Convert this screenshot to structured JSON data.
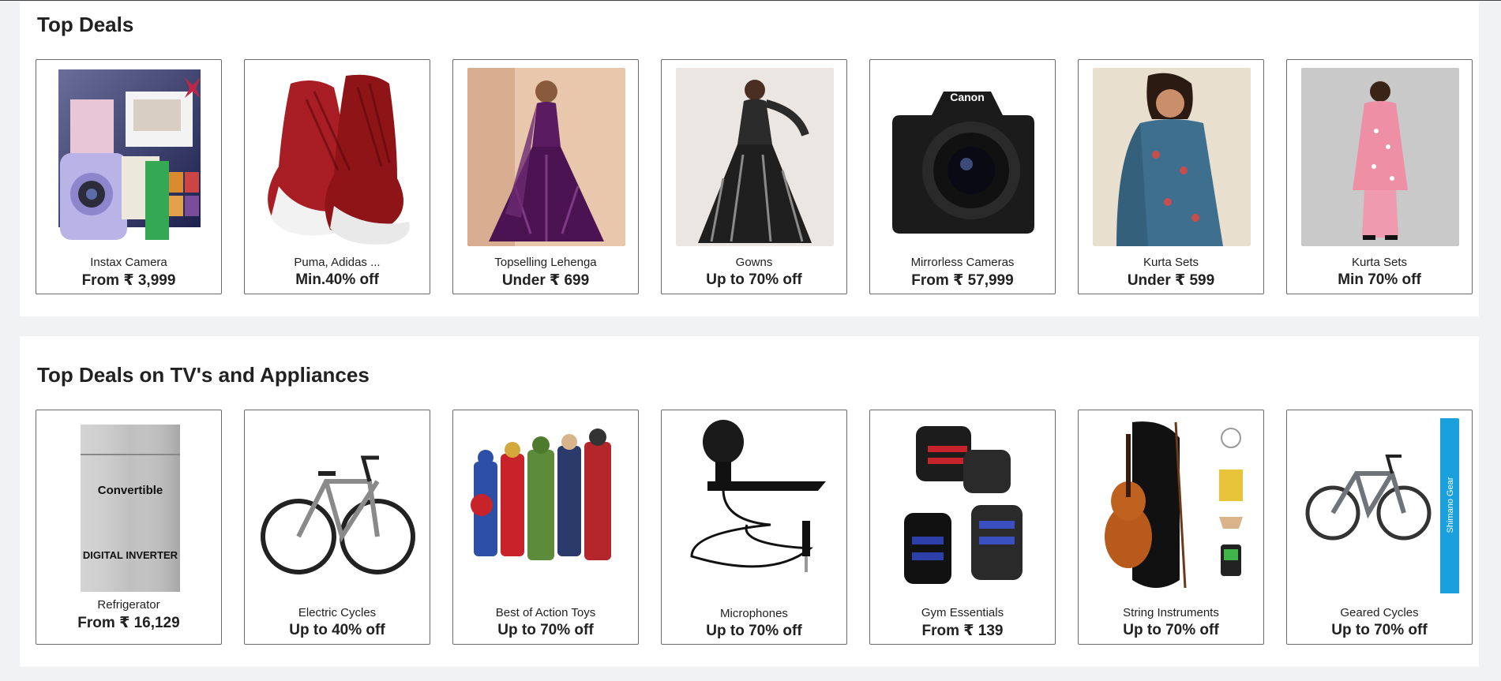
{
  "sections": [
    {
      "title": "Top Deals",
      "cards": [
        {
          "label": "Instax Camera",
          "price": "From ₹ 3,999",
          "image": "instax-camera"
        },
        {
          "label": "Puma, Adidas ...",
          "price": "Min.40% off",
          "image": "sneakers"
        },
        {
          "label": "Topselling Lehenga",
          "price": "Under ₹ 699",
          "image": "lehenga"
        },
        {
          "label": "Gowns",
          "price": "Up to 70% off",
          "image": "gown"
        },
        {
          "label": "Mirrorless Cameras",
          "price": "From ₹ 57,999",
          "image": "canon-camera",
          "brand": "Canon"
        },
        {
          "label": "Kurta Sets",
          "price": "Under ₹ 599",
          "image": "blue-kurta-set"
        },
        {
          "label": "Kurta Sets",
          "price": "Min 70% off",
          "image": "pink-kurta-set"
        }
      ]
    },
    {
      "title": "Top Deals on TV's and Appliances",
      "cards": [
        {
          "label": "Refrigerator",
          "price": "From ₹ 16,129",
          "image": "refrigerator",
          "badge_text": "Convertible",
          "badge_sub": "DIGITAL INVERTER"
        },
        {
          "label": "Electric Cycles",
          "price": "Up to 40% off",
          "image": "bicycle"
        },
        {
          "label": "Best of Action Toys",
          "price": "Up to 70% off",
          "image": "action-figures"
        },
        {
          "label": "Microphones",
          "price": "Up to 70% off",
          "image": "lapel-microphone"
        },
        {
          "label": "Gym Essentials",
          "price": "From ₹ 139",
          "image": "wrist-wraps"
        },
        {
          "label": "String Instruments",
          "price": "Up to 70% off",
          "image": "violin"
        },
        {
          "label": "Geared Cycles",
          "price": "Up to 70% off",
          "image": "geared-cycle",
          "side_label": "Shimano Gear"
        }
      ]
    }
  ]
}
